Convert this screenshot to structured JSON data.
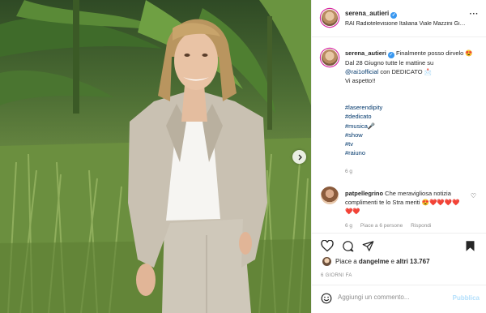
{
  "header": {
    "username": "serena_autieri",
    "location": "RAI Radiotelevisione Italiana Viale Mazzini Giu...",
    "more_icon": "more-horizontal-icon"
  },
  "caption": {
    "username": "serena_autieri",
    "line1": " Finalmente posso dirvelo 😍",
    "line2": "Dal 28 Giugno tutte le mattine su",
    "mention": "@rai1official",
    "line3": " con DEDICATO 📩",
    "line4": "Vi aspetto!!",
    "hashtags": [
      "#laserendipity",
      "#dedicato",
      "#musica🎤",
      "#show",
      "#tv",
      "#raiuno"
    ],
    "time": "6 g"
  },
  "comment": {
    "username": "patpellegrino",
    "text": " Che meravigliosa notizia complimenti te lo Stra meriti 😍❤️❤️❤️❤️❤️❤️",
    "time": "6 g",
    "likes": "Piace a 6 persone",
    "reply": "Rispondi"
  },
  "likes": {
    "prefix": "Piace a ",
    "user": "dangelme",
    "middle": " e ",
    "others": "altri 13.767"
  },
  "date": "6 GIORNI FA",
  "add_comment": {
    "placeholder": "Aggiungi un commento...",
    "post_label": "Pubblica"
  },
  "colors": {
    "link": "#00376b",
    "verified": "#3897f0",
    "muted": "#8e8e8e",
    "post_button_disabled": "#b2dffc"
  }
}
